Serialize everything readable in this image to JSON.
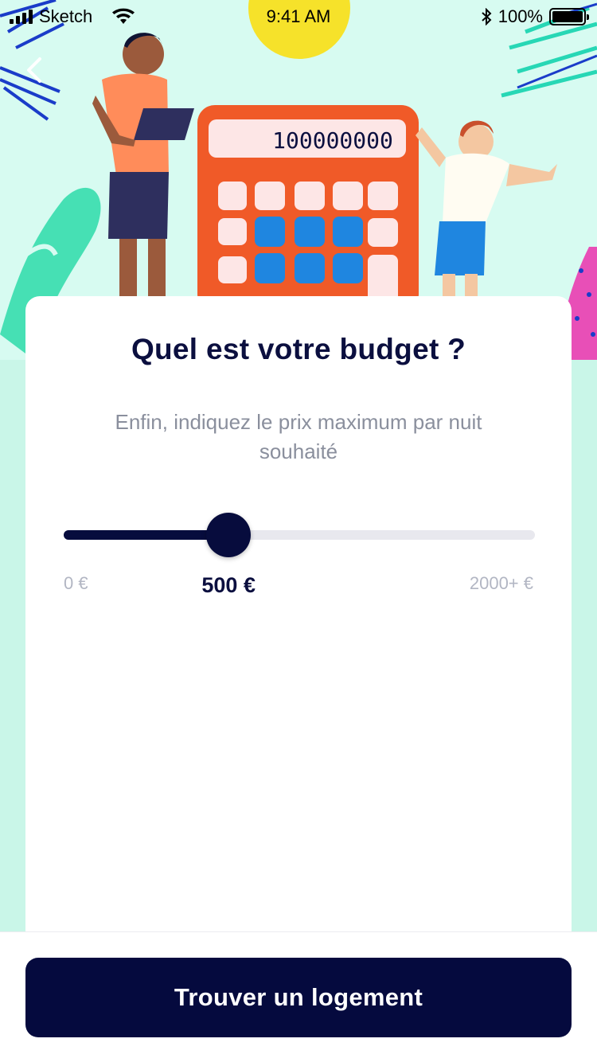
{
  "status_bar": {
    "carrier": "Sketch",
    "time": "9:41 AM",
    "battery": "100%"
  },
  "hero": {
    "calculator_display": "100000000"
  },
  "question": {
    "title": "Quel est votre budget ?",
    "subtitle": "Enfin, indiquez le prix maximum par nuit souhaité"
  },
  "budget_slider": {
    "min_label": "0 €",
    "max_label": "2000+ €",
    "value_label": "500 €",
    "value_fraction": 0.35
  },
  "cta": {
    "label": "Trouver un logement"
  },
  "colors": {
    "primary": "#050a3e",
    "background": "#c9f6e8",
    "muted_text": "#8a8f9d"
  }
}
